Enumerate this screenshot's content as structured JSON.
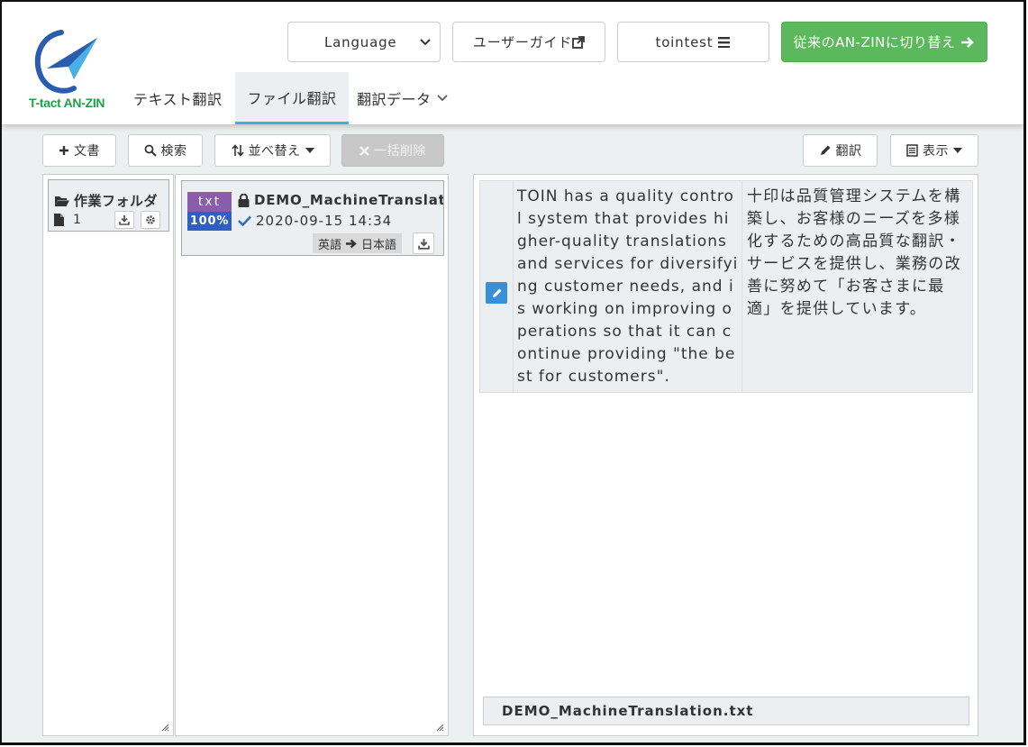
{
  "brand": {
    "logo_text": "T-tact AN-ZIN",
    "accent": "#5cb85c",
    "tab_underline": "#3aaee0"
  },
  "header": {
    "language_label": "Language",
    "guide_label": "ユーザーガイド",
    "user_label": "tointest",
    "switch_label": "従来のAN-ZINに切り替え"
  },
  "nav": {
    "text_translation": "テキスト翻訳",
    "file_translation": "ファイル翻訳",
    "translation_data": "翻訳データ"
  },
  "toolbar": {
    "add_doc": "文書",
    "search": "検索",
    "sort": "並べ替え",
    "bulk_delete": "一括削除",
    "translate": "翻訳",
    "display": "表示"
  },
  "folder": {
    "name": "作業フォルダ",
    "count": "1"
  },
  "file": {
    "type": "txt",
    "progress": "100%",
    "name": "DEMO_MachineTranslat",
    "date": "2020-09-15 14:34",
    "source_lang": "英語",
    "target_lang": "日本語"
  },
  "segment": {
    "source": "TOIN has a quality control system that provides higher-quality translations and services for diversifying customer needs, and is working on improving operations so that it can continue providing \"the best for customers\".",
    "target": "十印は品質管理システムを構築し、お客様のニーズを多様化するための高品質な翻訳・サービスを提供し、業務の改善に努めて「お客さまに最適」を提供しています。"
  },
  "footer": {
    "filename": "DEMO_MachineTranslation.txt"
  }
}
